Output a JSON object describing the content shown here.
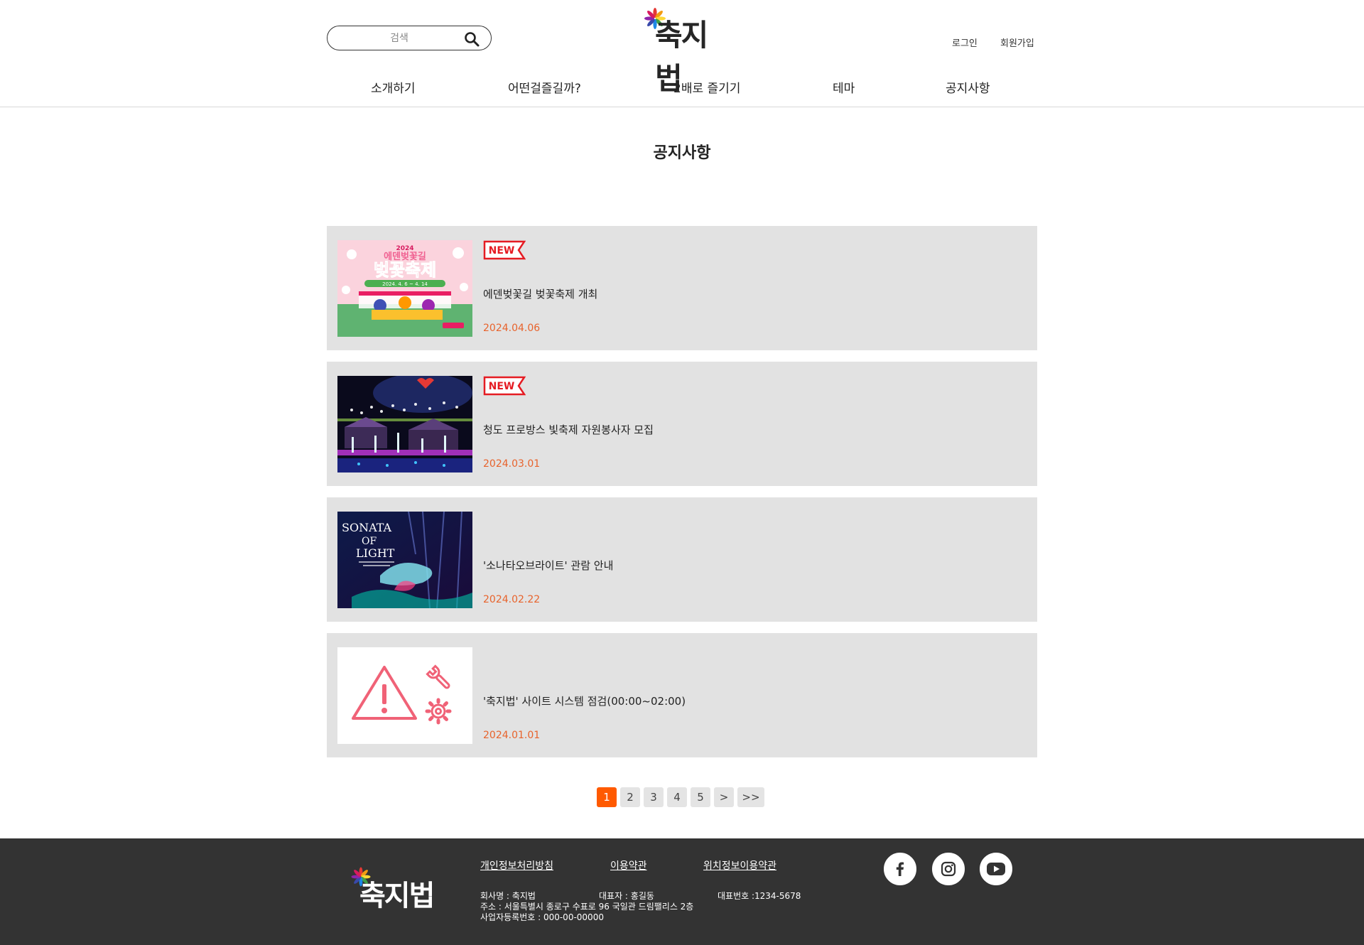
{
  "header": {
    "search_placeholder": "검색",
    "logo_text": "축지법",
    "login_label": "로그인",
    "signup_label": "회원가입",
    "nav": [
      "소개하기",
      "어떤걸즐길까?",
      "2배로 즐기기",
      "테마",
      "공지사항"
    ]
  },
  "page_title": "공지사항",
  "badge_label": "NEW",
  "notices": [
    {
      "title": "에덴벚꽃길 벚꽃축제 개최",
      "date": "2024.04.06",
      "is_new": true,
      "thumb_text": "벚꽃축제",
      "thumb_top": "2024",
      "thumb_sub": "에덴벚꽃길",
      "thumb_date": "2024. 4. 6 ~ 4. 14"
    },
    {
      "title": "청도 프로방스 빛축제 자원봉사자 모집",
      "date": "2024.03.01",
      "is_new": true
    },
    {
      "title": "'소나타오브라이트' 관람 안내",
      "date": "2024.02.22",
      "is_new": false,
      "thumb_lines": [
        "SONATA",
        "OF",
        "LIGHT"
      ]
    },
    {
      "title": "'축지법' 사이트 시스템 점검(00:00~02:00)",
      "date": "2024.01.01",
      "is_new": false
    }
  ],
  "pagination": {
    "pages": [
      "1",
      "2",
      "3",
      "4",
      "5"
    ],
    "next": ">",
    "last": ">>",
    "current": "1"
  },
  "footer": {
    "logo_text": "축지법",
    "links": [
      "개인정보처리방침",
      "이용약관",
      "위치정보이용약관"
    ],
    "company": "회사명 : 축지법",
    "ceo": "대표자 : 홍길동",
    "phone": "대표번호 :1234-5678",
    "address": "주소 : 서울특별시 종로구 수표로 96 국일관 드림팰리스 2층",
    "business_no": "사업자등록번호 : 000-00-00000",
    "social": [
      "facebook-icon",
      "instagram-icon",
      "youtube-icon"
    ]
  },
  "colors": {
    "accent": "#ff5a00",
    "date": "#e8632c",
    "card_bg": "#e2e2e2",
    "footer_bg": "#333333",
    "badge": "#e51c23"
  }
}
